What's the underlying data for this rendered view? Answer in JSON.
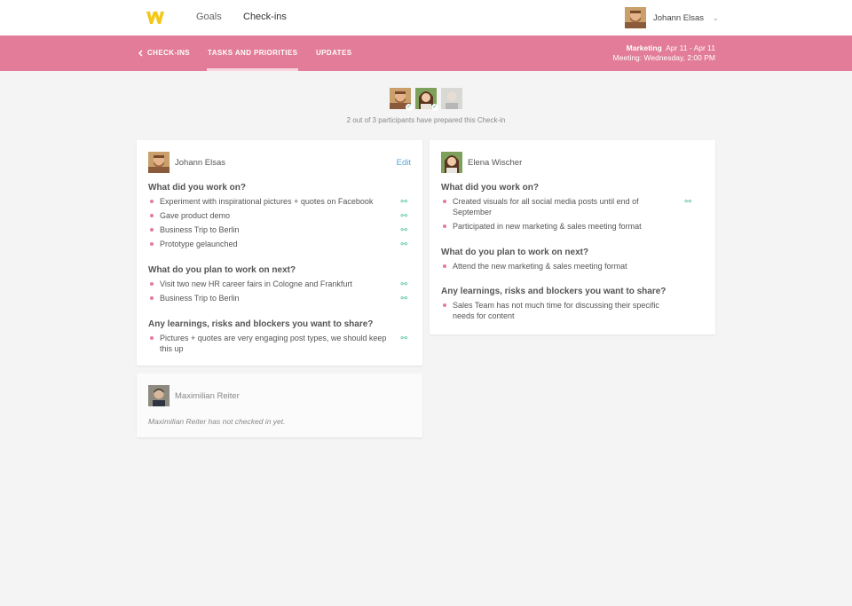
{
  "nav": {
    "goals": "Goals",
    "checkins": "Check-ins",
    "user_name": "Johann Elsas",
    "chevron": "⌄"
  },
  "subnav": {
    "back_label": "CHECK-INS",
    "tasks_label": "TASKS AND PRIORITIES",
    "updates_label": "UPDATES",
    "team": "Marketing",
    "date_range": "Apr 11 - Apr 11",
    "meeting": "Meeting: Wednesday, 2:00 PM"
  },
  "participants": {
    "note": "2 out of 3 participants have prepared this Check-in",
    "count_prepared": 2,
    "count_total": 3
  },
  "cards": {
    "johann": {
      "name": "Johann Elsas",
      "edit": "Edit",
      "q1": "What did you work on?",
      "q1_items": [
        "Experiment with inspirational pictures + quotes on Facebook",
        "Gave product demo",
        "Business Trip to Berlin",
        "Prototype gelaunched"
      ],
      "q2": "What do you plan to work on next?",
      "q2_items": [
        "Visit two new HR career fairs in Cologne and Frankfurt",
        "Business Trip to Berlin"
      ],
      "q3": "Any learnings, risks and blockers you want to share?",
      "q3_items": [
        "Pictures + quotes are very engaging post types, we should keep this up"
      ]
    },
    "elena": {
      "name": "Elena Wischer",
      "q1": "What did you work on?",
      "q1_items": [
        "Created visuals for all social media posts until end of September",
        "Participated in new marketing & sales meeting format"
      ],
      "q2": "What do you plan to work on next?",
      "q2_items": [
        "Attend the new marketing & sales meeting format"
      ],
      "q3": "Any learnings, risks and blockers you want to share?",
      "q3_items": [
        "Sales Team has not much time for discussing their specific needs for content"
      ]
    },
    "max": {
      "name": "Maximilian Reiter",
      "status": "Maximilian Reiter has not checked in yet."
    }
  },
  "icons": {
    "link_icon": "link-icon",
    "check_icon": "check-icon"
  },
  "colors": {
    "brand_pink": "#e27c98",
    "logo_yellow": "#f2c81a",
    "link_green": "#3fbf94",
    "edit_blue": "#5aa5d6"
  }
}
